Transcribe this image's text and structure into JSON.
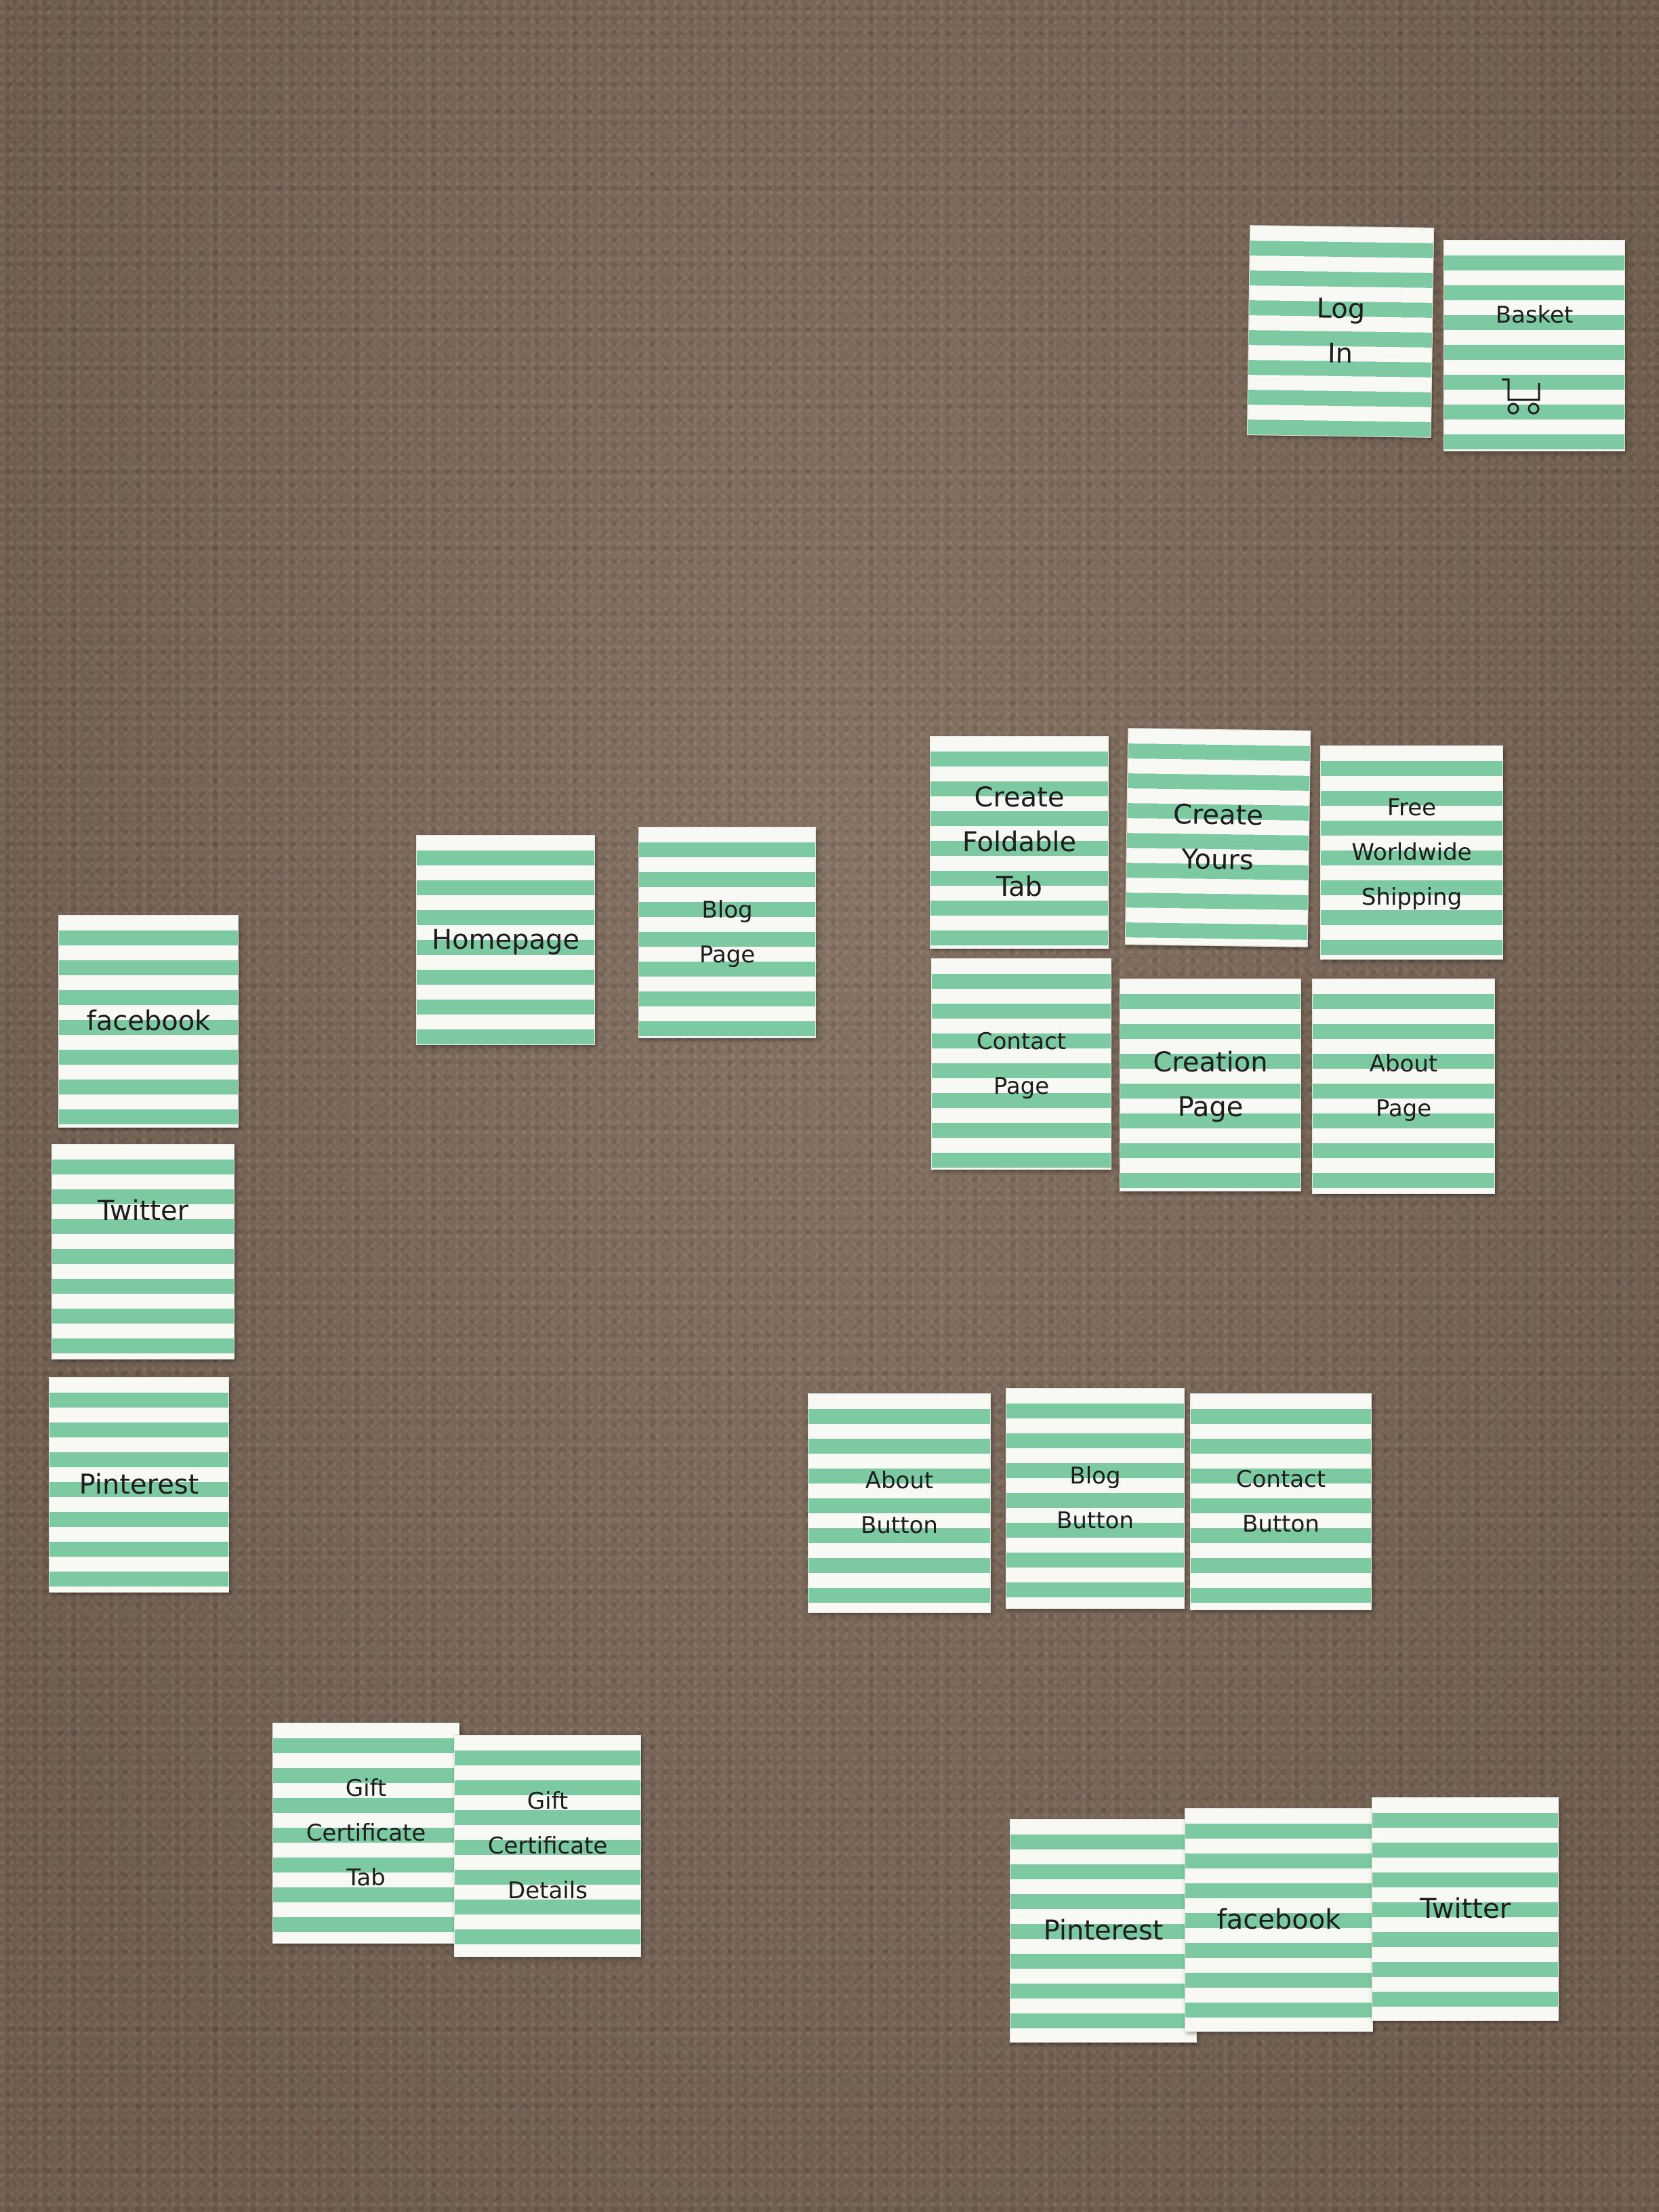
{
  "cards": {
    "log_in": "Log\nIn",
    "basket": "Basket",
    "create_foldable_tab": "Create\nFoldable\nTab",
    "create_yours": "Create\nYours",
    "free_worldwide_shipping": "Free\nWorldwide\nShipping",
    "homepage": "Homepage",
    "blog_page": "Blog\nPage",
    "contact_page": "Contact\nPage",
    "creation_page": "Creation\nPage",
    "about_page": "About\nPage",
    "facebook_left": "facebook",
    "twitter_left": "Twitter",
    "pinterest_left": "Pinterest",
    "about_button": "About\nButton",
    "blog_button": "Blog\nButton",
    "contact_button": "Contact\nButton",
    "gift_certificate_tab": "Gift\nCertificate\nTab",
    "gift_certificate_details": "Gift\nCertificate\nDetails",
    "pinterest_bottom": "Pinterest",
    "facebook_bottom": "facebook",
    "twitter_bottom": "Twitter"
  },
  "icons": {
    "basket": "shopping-cart-icon"
  },
  "colors": {
    "stripe_green": "#7cc9a2",
    "paper_white": "#f8f8f4",
    "carpet_brown": "#7d6a59"
  }
}
